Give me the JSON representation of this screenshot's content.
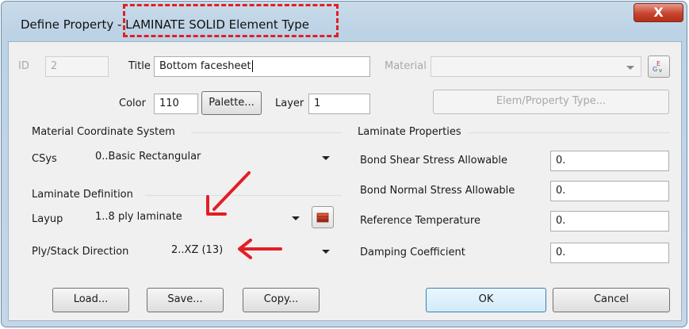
{
  "window": {
    "title_prefix": "Define Property - ",
    "title_main": "LAMINATE SOLID Element Type",
    "close_label": "X"
  },
  "header": {
    "id_label": "ID",
    "id_value": "2",
    "title_label": "Title",
    "title_value": "Bottom facesheet",
    "material_label": "Material",
    "material_value": "",
    "color_label": "Color",
    "color_value": "110",
    "palette_label": "Palette...",
    "layer_label": "Layer",
    "layer_value": "1",
    "elem_type_label": "Elem/Property Type..."
  },
  "coord": {
    "group_label": "Material Coordinate System",
    "csys_label": "CSys",
    "csys_value": "0..Basic Rectangular"
  },
  "laminate_def": {
    "group_label": "Laminate Definition",
    "layup_label": "Layup",
    "layup_value": "1..8 ply laminate",
    "ply_dir_label": "Ply/Stack Direction",
    "ply_dir_value": "2..XZ (13)"
  },
  "laminate_props": {
    "group_label": "Laminate Properties",
    "rows": [
      {
        "label": "Bond Shear Stress Allowable",
        "value": "0."
      },
      {
        "label": "Bond Normal Stress Allowable",
        "value": "0."
      },
      {
        "label": "Reference Temperature",
        "value": "0."
      },
      {
        "label": "Damping Coefficient",
        "value": "0."
      }
    ]
  },
  "footer": {
    "load_label": "Load...",
    "save_label": "Save...",
    "copy_label": "Copy...",
    "ok_label": "OK",
    "cancel_label": "Cancel"
  },
  "colors": {
    "annotation_red": "#e31e24",
    "titlebar": "#bcd2e5",
    "dialog_bg": "#f0f0f0",
    "close_button": "#c7442f"
  },
  "icons": [
    "close-icon",
    "material-lookup-icon",
    "layup-editor-icon",
    "dropdown-arrow-icon"
  ]
}
